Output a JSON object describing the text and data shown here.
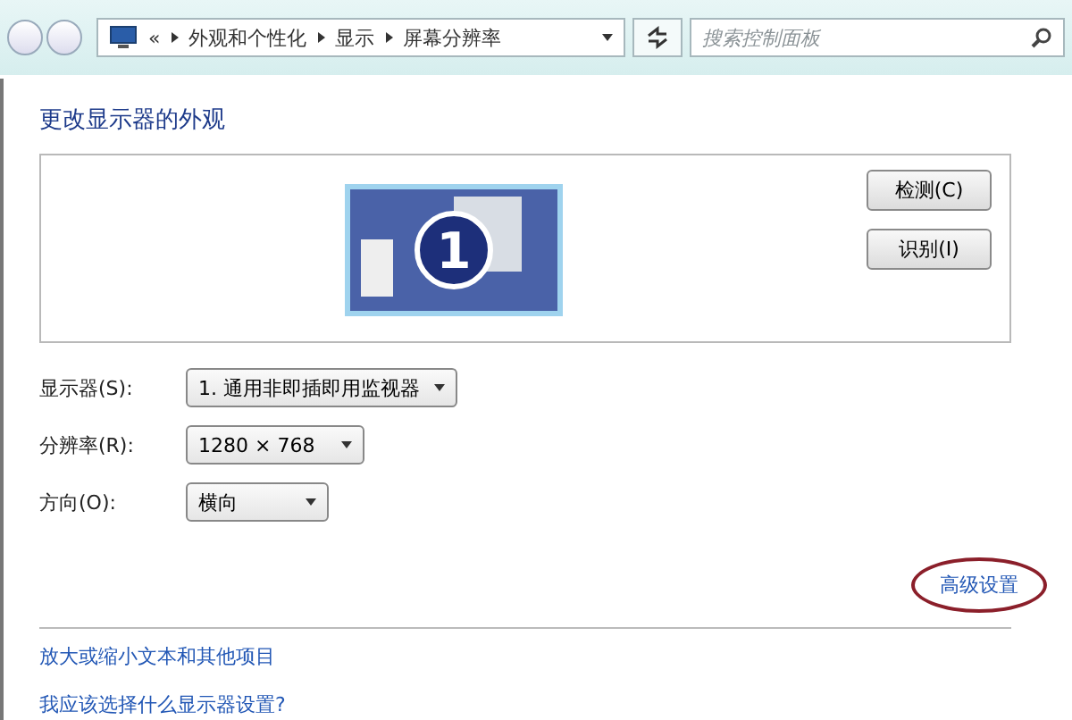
{
  "address_bar": {
    "overflow": "«",
    "crumbs": [
      "外观和个性化",
      "显示",
      "屏幕分辨率"
    ]
  },
  "search": {
    "placeholder": "搜索控制面板"
  },
  "heading": "更改显示器的外观",
  "preview": {
    "monitor_number": "1",
    "buttons": [
      "检测(C)",
      "识别(I)"
    ]
  },
  "settings": [
    {
      "label": "显示器(S):",
      "value": "1. 通用非即插即用监视器"
    },
    {
      "label": "分辨率(R):",
      "value": "1280 × 768"
    },
    {
      "label": "方向(O):",
      "value": "横向"
    }
  ],
  "advanced_link": {
    "text": "高级设置",
    "circled": true
  },
  "links": [
    "放大或缩小文本和其他项目",
    "我应该选择什么显示器设置?"
  ]
}
